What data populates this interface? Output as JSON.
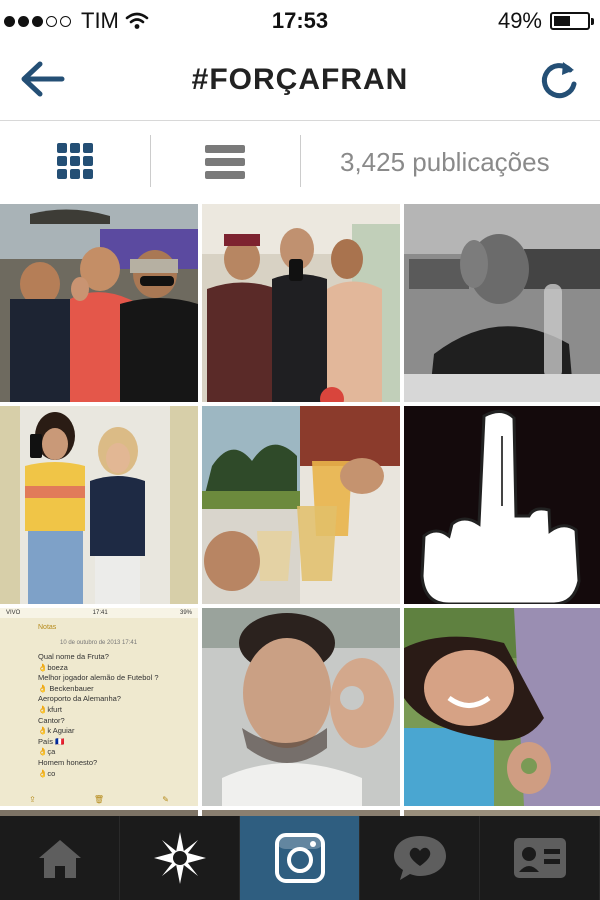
{
  "status_bar": {
    "carrier": "TIM",
    "time": "17:53",
    "battery_percent": "49%",
    "battery_level": 0.49,
    "signal_bars": 3,
    "signal_total": 5
  },
  "header": {
    "title": "#FORÇAFRAN",
    "back_icon": "arrow-left-icon",
    "refresh_icon": "refresh-icon"
  },
  "view_toggle": {
    "grid_icon": "grid-icon",
    "list_icon": "list-icon",
    "post_count": "3,425 publicações"
  },
  "photos": [
    {
      "id": 1,
      "description": "group-selfie"
    },
    {
      "id": 2,
      "description": "three-friends"
    },
    {
      "id": 3,
      "description": "office-ok-sign"
    },
    {
      "id": 4,
      "description": "two-women-mirror"
    },
    {
      "id": 5,
      "description": "beer-glasses"
    },
    {
      "id": 6,
      "description": "middle-finger-drawing"
    },
    {
      "id": 7,
      "description": "notes-screenshot"
    },
    {
      "id": 8,
      "description": "man-ok-sign"
    },
    {
      "id": 9,
      "description": "woman-smiling"
    }
  ],
  "notes_screenshot": {
    "carrier": "VIVO",
    "time": "17:41",
    "battery": "39%",
    "back_label": "Notas",
    "date": "10 de outubro de 2013 17:41",
    "lines": [
      "Qual nome da Fruta?",
      "👌boeza",
      "Melhor jogador alemão de Futebol ?",
      "👌 Beckenbauer",
      "Aeroporto da Alemanha?",
      "👌kfurt",
      "Cantor?",
      "👌k Aguiar",
      "País 🇫🇷",
      "👌ça",
      "Homem honesto?",
      "👌co"
    ]
  },
  "tab_bar": {
    "tabs": [
      {
        "name": "home",
        "icon": "home-icon",
        "active": false
      },
      {
        "name": "explore",
        "icon": "explore-star-icon",
        "active": false
      },
      {
        "name": "camera",
        "icon": "camera-icon",
        "active": true
      },
      {
        "name": "news",
        "icon": "heart-bubble-icon",
        "active": false
      },
      {
        "name": "profile",
        "icon": "profile-card-icon",
        "active": false
      }
    ]
  },
  "colors": {
    "accent": "#244f75",
    "tab_bar_bg": "#1b1b1b",
    "tab_active_bg": "#2f5e80",
    "muted_text": "#8a8a8a"
  }
}
